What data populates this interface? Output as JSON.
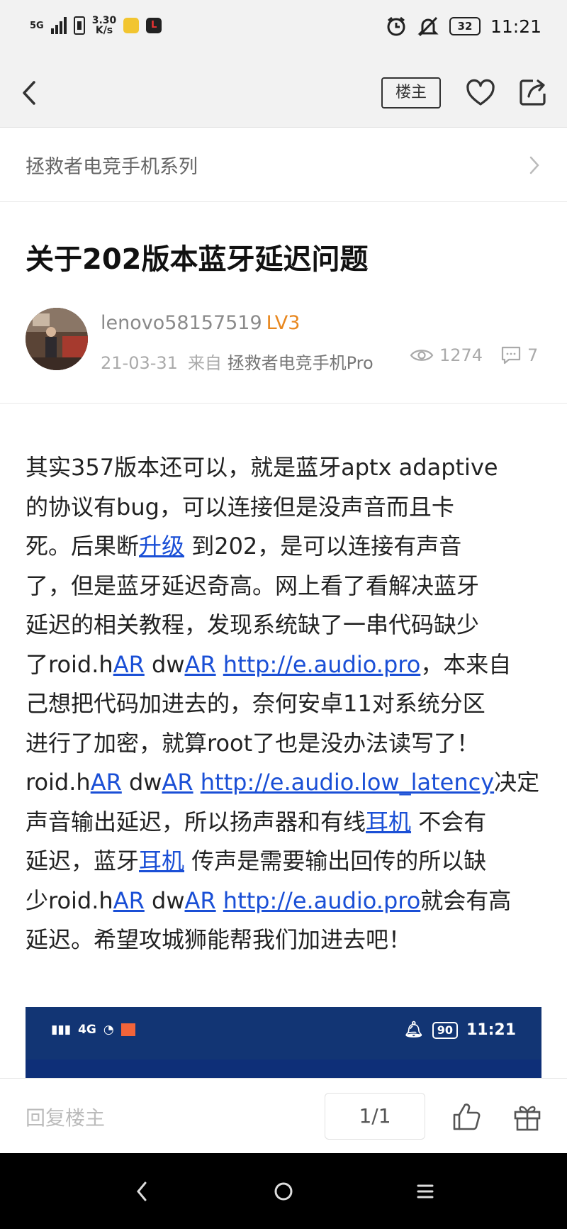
{
  "status_bar": {
    "network": "5G",
    "speed_value": "3.30",
    "speed_unit": "K/s",
    "battery": "32",
    "time": "11:21"
  },
  "nav": {
    "louzhu_label": "楼主"
  },
  "breadcrumb": {
    "label": "拯救者电竞手机系列"
  },
  "post": {
    "title": "关于202版本蓝牙延迟问题",
    "author": {
      "username": "lenovo58157519",
      "level": "LV3"
    },
    "date": "21-03-31",
    "from_label": "来自",
    "source_device": "拯救者电竞手机Pro",
    "views": "1274",
    "comments": "7",
    "body": {
      "l1": "其实357版本还可以，就是蓝牙aptx adaptive",
      "l2": "的协议有bug，可以连接但是没声音而且卡",
      "l3a": "死。后果断",
      "l3_link": "升级",
      "l3b": " 到202，是可以连接有声音",
      "l4": "了，但是蓝牙延迟奇高。网上看了看解决蓝牙",
      "l5": "延迟的相关教程，发现系统缺了一串代码缺少",
      "l6a": "了roid.h",
      "l6_ar1": "AR",
      "l6b": " dw",
      "l6_ar2": "AR",
      "l6c": " ",
      "l6_url": "http://e.audio.pro",
      "l6d": "，本来自",
      "l7": "己想把代码加进去的，奈何安卓11对系统分区",
      "l8": "进行了加密，就算root了也是没办法读写了！",
      "l9a": "roid.h",
      "l9_ar1": "AR",
      "l9b": " dw",
      "l9_ar2": "AR",
      "l9c": " ",
      "l9_url": "http://e.audio.low_latency",
      "l9d": "决定",
      "l10a": "声音输出延迟，所以扬声器和有线",
      "l10_link": "耳机",
      "l10b": " 不会有",
      "l11a": "延迟，蓝牙",
      "l11_link": "耳机",
      "l11b": " 传声是需要输出回传的所以缺",
      "l12a": "少roid.h",
      "l12_ar1": "AR",
      "l12b": " dw",
      "l12_ar2": "AR",
      "l12c": " ",
      "l12_url": "http://e.audio.pro",
      "l12d": "就会有高",
      "l13": "延迟。希望攻城狮能帮我们加进去吧！"
    }
  },
  "embedded_screenshot": {
    "signal_label": "4G",
    "battery": "90",
    "time": "11:21"
  },
  "bottom_bar": {
    "reply_placeholder": "回复楼主",
    "page_indicator": "1/1"
  },
  "colors": {
    "link": "#1a4fd6",
    "level": "#e8871e",
    "embed_bg": "#0e2f78"
  }
}
